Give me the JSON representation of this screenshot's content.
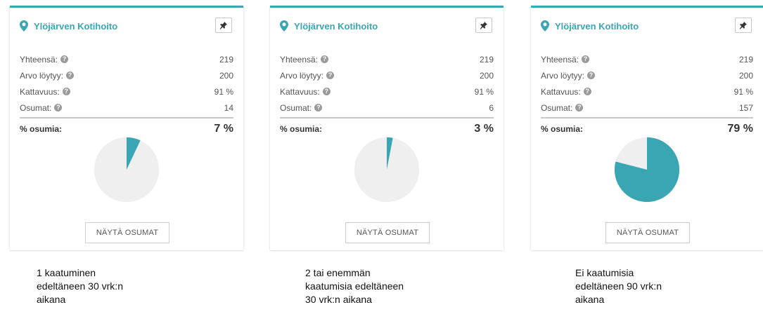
{
  "cards": [
    {
      "title": "Ylöjärven Kotihoito",
      "stats": [
        {
          "label": "Yhteensä:",
          "value": "219"
        },
        {
          "label": "Arvo löytyy:",
          "value": "200"
        },
        {
          "label": "Kattavuus:",
          "value": "91 %"
        },
        {
          "label": "Osumat:",
          "value": "14"
        }
      ],
      "hits_label": "% osumia:",
      "hits_value": "7 %",
      "hits_fraction": 0.07,
      "button_label": "NÄYTÄ OSUMAT"
    },
    {
      "title": "Ylöjärven Kotihoito",
      "stats": [
        {
          "label": "Yhteensä:",
          "value": "219"
        },
        {
          "label": "Arvo löytyy:",
          "value": "200"
        },
        {
          "label": "Kattavuus:",
          "value": "91 %"
        },
        {
          "label": "Osumat:",
          "value": "6"
        }
      ],
      "hits_label": "% osumia:",
      "hits_value": "3 %",
      "hits_fraction": 0.03,
      "button_label": "NÄYTÄ OSUMAT"
    },
    {
      "title": "Ylöjärven Kotihoito",
      "stats": [
        {
          "label": "Yhteensä:",
          "value": "219"
        },
        {
          "label": "Arvo löytyy:",
          "value": "200"
        },
        {
          "label": "Kattavuus:",
          "value": "91 %"
        },
        {
          "label": "Osumat:",
          "value": "157"
        }
      ],
      "hits_label": "% osumia:",
      "hits_value": "79 %",
      "hits_fraction": 0.79,
      "button_label": "NÄYTÄ OSUMAT"
    }
  ],
  "captions": [
    [
      "1 kaatuminen",
      "edeltäneen 30 vrk:n",
      "aikana"
    ],
    [
      "2 tai enemmän",
      "kaatumisia edeltäneen",
      "30 vrk:n aikana"
    ],
    [
      "Ei kaatumisia",
      "edeltäneen 90 vrk:n",
      "aikana"
    ]
  ],
  "colors": {
    "accent": "#3aa6b4",
    "pie_empty": "#efefef"
  },
  "icons": {
    "location": "map-marker-icon",
    "pin": "pin-icon",
    "help": "question-circle-icon"
  }
}
